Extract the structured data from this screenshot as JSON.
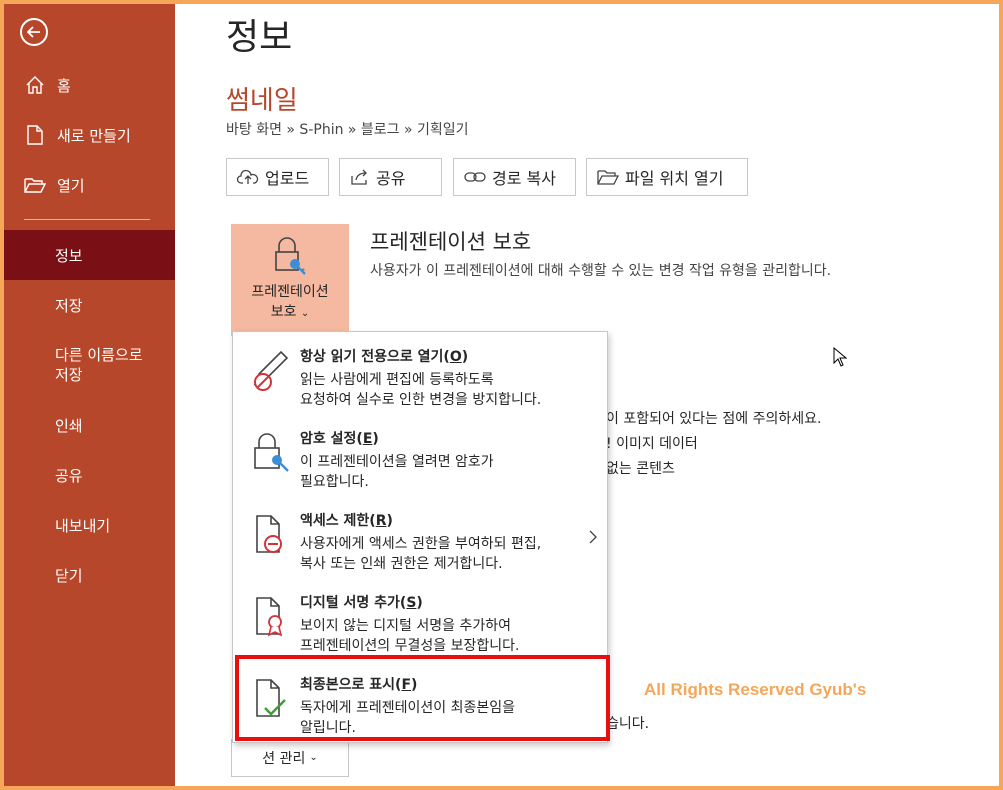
{
  "sidebar": {
    "items": [
      {
        "label": "홈",
        "icon": "home-icon"
      },
      {
        "label": "새로 만들기",
        "icon": "new-document-icon"
      },
      {
        "label": "열기",
        "icon": "open-folder-icon"
      },
      {
        "label": "정보"
      },
      {
        "label": "저장"
      },
      {
        "label": "다른 이름으로 저장"
      },
      {
        "label": "인쇄"
      },
      {
        "label": "공유"
      },
      {
        "label": "내보내기"
      },
      {
        "label": "닫기"
      }
    ],
    "active": "정보"
  },
  "main": {
    "page_title": "정보",
    "file_name": "썸네일",
    "breadcrumb": "바탕 화면 » S-Phin » 블로그 » 기획일기",
    "toolbar": [
      {
        "label": "업로드",
        "icon": "upload-icon"
      },
      {
        "label": "공유",
        "icon": "share-icon"
      },
      {
        "label": "경로 복사",
        "icon": "link-icon"
      },
      {
        "label": "파일 위치 열기",
        "icon": "folder-icon"
      }
    ],
    "protect": {
      "tile_line1": "프레젠테이션",
      "tile_line2": "보호",
      "heading": "프레젠테이션 보호",
      "description": "사용자가 이 프레젠테이션에 대해 수행할 수 있는 변경 작업 유형을 관리합니다."
    },
    "background_text": {
      "line1": "이 포함되어 있다는 점에 주의하세요.",
      "line2": "! 이미지 데이터",
      "line3": "없는 콘텐츠",
      "line4": "습니다."
    },
    "manage_tile_label": "션 관리"
  },
  "dropdown": {
    "items": [
      {
        "title": "항상 읽기 전용으로 열기",
        "key": "O",
        "desc1": "읽는 사람에게 편집에 등록하도록",
        "desc2": "요청하여 실수로 인한 변경을 방지합니다.",
        "icon": "pencil-no-icon"
      },
      {
        "title": "암호 설정",
        "key": "E",
        "desc1": "이 프레젠테이션을 열려면 암호가",
        "desc2": "필요합니다.",
        "icon": "lock-key-icon"
      },
      {
        "title": "액세스 제한",
        "key": "R",
        "desc1": "사용자에게 액세스 권한을 부여하되 편집,",
        "desc2": "복사 또는 인쇄 권한은 제거합니다.",
        "icon": "restrict-access-icon"
      },
      {
        "title": "디지털 서명 추가",
        "key": "S",
        "desc1": "보이지 않는 디지털 서명을 추가하여",
        "desc2": "프레젠테이션의 무결성을 보장합니다.",
        "icon": "signature-ribbon-icon"
      },
      {
        "title": "최종본으로 표시",
        "key": "F",
        "desc1": "독자에게 프레젠테이션이 최종본임을",
        "desc2": "알립니다.",
        "icon": "mark-final-icon"
      }
    ]
  },
  "watermark": "All Rights Reserved Gyub's",
  "colors": {
    "sidebar": "#b7472a",
    "sidebar_active": "#7b0f16",
    "accent": "#b7472a",
    "tile": "#f4b9a0",
    "highlight": "#e8100f",
    "frame": "#f6a659"
  }
}
